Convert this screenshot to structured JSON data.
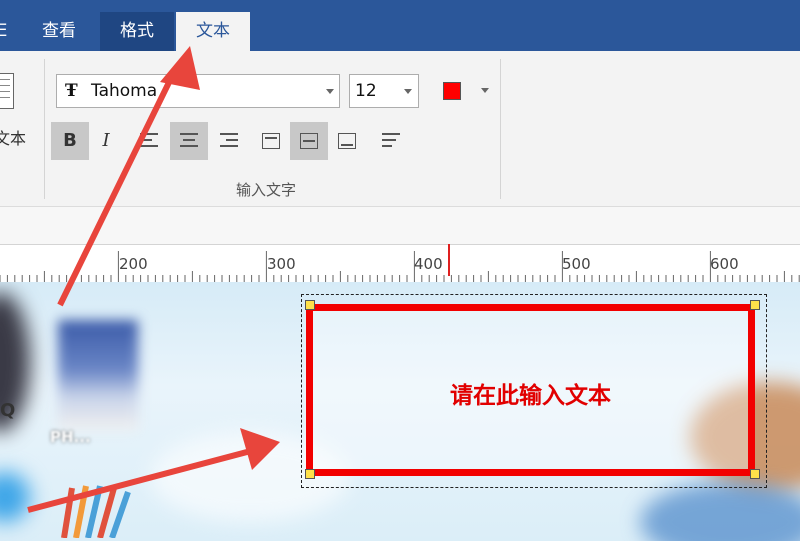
{
  "tabs": [
    {
      "label": "查看"
    },
    {
      "label": "格式"
    },
    {
      "label": "文本"
    }
  ],
  "partial_tab_char": "E",
  "ribbon": {
    "left_partial_label": "文本",
    "font_icon_glyph": "Ŧ",
    "font_name": "Tahoma",
    "font_size": "12",
    "font_color": "#ff0000",
    "bold_label": "B",
    "italic_label": "I",
    "group_label": "输入文字"
  },
  "ruler": {
    "ticks": [
      "200",
      "300",
      "400",
      "500",
      "600"
    ]
  },
  "canvas": {
    "left_letter": "Q",
    "blurred_icon_label": "PH...",
    "text_box_content": "请在此输入文本"
  },
  "colors": {
    "accent_bar": "#2b579a",
    "text_box_border": "#f20000",
    "text_color": "#e10000",
    "annotation_arrow": "#e8453c"
  }
}
